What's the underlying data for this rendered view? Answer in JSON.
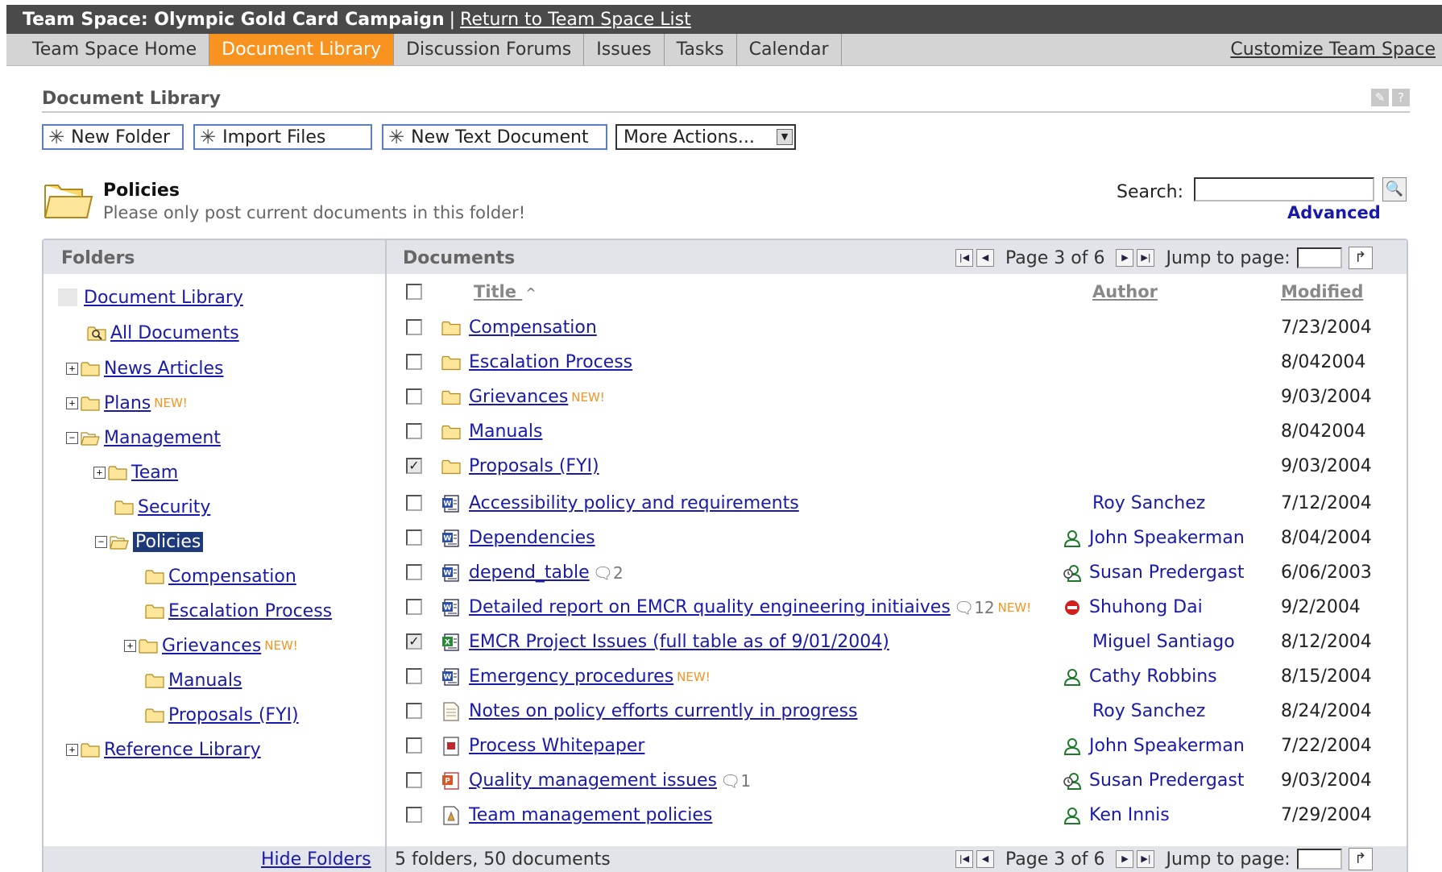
{
  "title_bar": {
    "title": "Team Space: Olympic Gold Card Campaign",
    "separator": "|",
    "return_link": "Return to Team Space List"
  },
  "tabs": [
    {
      "label": "Team Space Home"
    },
    {
      "label": "Document Library",
      "active": true
    },
    {
      "label": "Discussion Forums"
    },
    {
      "label": "Issues"
    },
    {
      "label": "Tasks"
    },
    {
      "label": "Calendar"
    }
  ],
  "customize_link": "Customize Team Space",
  "heading": "Document Library",
  "toolbar": {
    "new_folder": "New Folder",
    "import_files": "Import Files",
    "new_text_document": "New Text Document",
    "more_actions": "More Actions..."
  },
  "folder_header": {
    "title": "Policies",
    "description": "Please only post current documents in this folder!"
  },
  "search": {
    "label": "Search:",
    "value": "",
    "advanced": "Advanced"
  },
  "folders_panel": {
    "title": "Folders",
    "hide_folders": "Hide Folders"
  },
  "documents_panel": {
    "title": "Documents",
    "summary": "5 folders, 50 documents"
  },
  "pager": {
    "text": "Page 3 of 6",
    "jump_label": "Jump to page:"
  },
  "tree": {
    "document_library": "Document Library",
    "all_documents": "All Documents",
    "news_articles": "News Articles",
    "plans": "Plans",
    "new_tag": "NEW!",
    "management": "Management",
    "team": "Team",
    "security": "Security",
    "policies": "Policies",
    "compensation": "Compensation",
    "escalation_process": "Escalation Process",
    "grievances": "Grievances",
    "manuals": "Manuals",
    "proposals": "Proposals (FYI)",
    "reference_library": "Reference Library",
    "expand": "+",
    "collapse": "−"
  },
  "columns": {
    "title": "Title",
    "sort_indicator": "^",
    "author": "Author",
    "modified": "Modified"
  },
  "rows": [
    {
      "title": "Compensation",
      "type": "folder",
      "author": "",
      "modified": "7/23/2004",
      "checked": false
    },
    {
      "title": "Escalation Process",
      "type": "folder",
      "author": "",
      "modified": "8/042004",
      "checked": false
    },
    {
      "title": "Grievances",
      "type": "folder",
      "new": "NEW!",
      "author": "",
      "modified": "9/03/2004",
      "checked": false
    },
    {
      "title": "Manuals",
      "type": "folder",
      "author": "",
      "modified": "8/042004",
      "checked": false
    },
    {
      "title": "Proposals (FYI)",
      "type": "folder",
      "author": "",
      "modified": "9/03/2004",
      "checked": true
    },
    {
      "title": "Accessibility policy and requirements",
      "type": "word",
      "author": "Roy Sanchez",
      "modified": "7/12/2004",
      "checked": false
    },
    {
      "title": "Dependencies",
      "type": "word",
      "author": "John Speakerman",
      "author_icon": "person-online-icon",
      "modified": "8/04/2004",
      "checked": false
    },
    {
      "title": "depend_table",
      "type": "word",
      "comments": "2",
      "author": "Susan Predergast",
      "author_icon": "person-idle-icon",
      "modified": "6/06/2003",
      "checked": false
    },
    {
      "title": "Detailed report on EMCR quality engineering initiaives",
      "type": "word",
      "comments": "12",
      "new": "NEW!",
      "author": "Shuhong Dai",
      "author_icon": "do-not-disturb-icon",
      "modified": "9/2/2004",
      "checked": false
    },
    {
      "title": "EMCR Project Issues (full table as of 9/01/2004)",
      "type": "excel",
      "author": "Miguel Santiago",
      "modified": "8/12/2004",
      "checked": true
    },
    {
      "title": "Emergency procedures",
      "type": "word",
      "new": "NEW!",
      "author": "Cathy Robbins",
      "author_icon": "person-online-icon",
      "modified": "8/15/2004",
      "checked": false
    },
    {
      "title": "Notes on policy efforts currently in progress",
      "type": "text",
      "author": "Roy Sanchez",
      "modified": "8/24/2004",
      "checked": false
    },
    {
      "title": "Process Whitepaper",
      "type": "pdf",
      "author": "John Speakerman",
      "author_icon": "person-online-icon",
      "modified": "7/22/2004",
      "checked": false
    },
    {
      "title": "Quality management issues",
      "type": "powerpoint",
      "comments": "1",
      "author": "Susan Predergast",
      "author_icon": "person-idle-icon",
      "modified": "9/03/2004",
      "checked": false
    },
    {
      "title": "Team management policies",
      "type": "document",
      "author": "Ken Innis",
      "author_icon": "person-online-icon",
      "modified": "7/29/2004",
      "checked": false
    }
  ],
  "colors": {
    "accent": "#f7931e",
    "link": "#1a1aa8",
    "titlebar": "#4a4a4a",
    "selected": "#1f3a7a"
  }
}
